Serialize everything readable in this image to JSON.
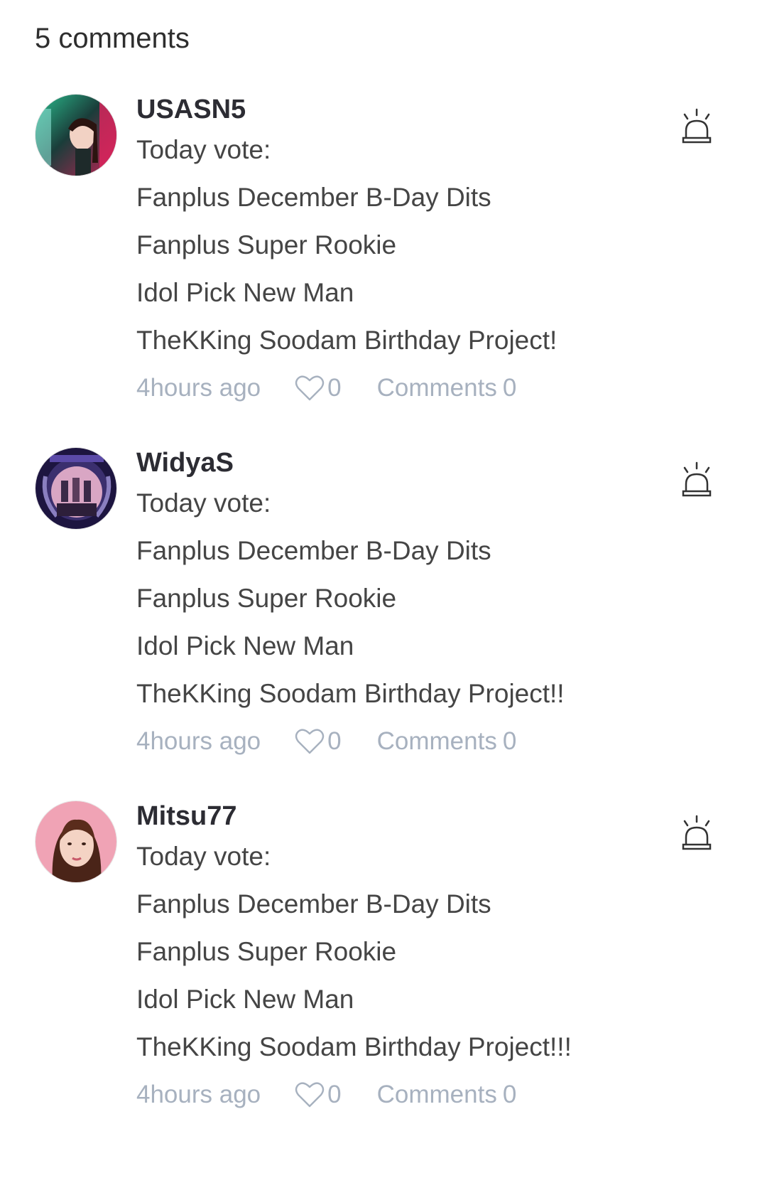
{
  "header": {
    "count_label": "5 comments"
  },
  "comments": [
    {
      "username": "USASN5",
      "lines": [
        "Today vote:",
        "Fanplus December B-Day Dits",
        "Fanplus Super Rookie",
        "Idol Pick New Man",
        "TheKKing Soodam Birthday Project!"
      ],
      "time": "4hours ago",
      "likes": "0",
      "comments_label": "Comments",
      "comments_count": "0"
    },
    {
      "username": "WidyaS",
      "lines": [
        "Today vote:",
        "Fanplus December B-Day Dits",
        "Fanplus Super Rookie",
        "Idol Pick New Man",
        "TheKKing Soodam Birthday Project!!"
      ],
      "time": "4hours ago",
      "likes": "0",
      "comments_label": "Comments",
      "comments_count": "0"
    },
    {
      "username": "Mitsu77",
      "lines": [
        "Today vote:",
        "Fanplus December B-Day Dits",
        "Fanplus Super Rookie",
        "Idol Pick New Man",
        "TheKKing Soodam Birthday Project!!!"
      ],
      "time": "4hours ago",
      "likes": "0",
      "comments_label": "Comments",
      "comments_count": "0"
    }
  ],
  "icons": {
    "like": "heart-outline-icon",
    "report": "siren-alarm-icon"
  },
  "colors": {
    "meta_text": "#a7b1bf",
    "username": "#2c2c33",
    "body_text": "#454545"
  }
}
